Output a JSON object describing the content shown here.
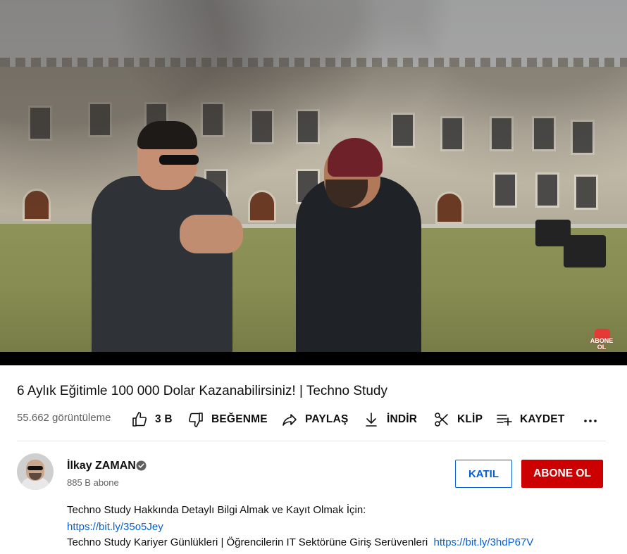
{
  "player": {
    "watermark": {
      "badge_line1": "ABONE",
      "badge_line2": "OL",
      "accent_color": "#e53935"
    }
  },
  "video": {
    "title": "6 Aylık Eğitimle 100 000 Dolar Kazanabilirsiniz! | Techno Study",
    "views": "55.662 görüntüleme"
  },
  "actions": {
    "like": {
      "label": "3 B",
      "icon": "thumbs-up-icon"
    },
    "dislike": {
      "label": "BEĞENME",
      "icon": "thumbs-down-icon"
    },
    "share": {
      "label": "PAYLAŞ",
      "icon": "share-icon"
    },
    "download": {
      "label": "İNDİR",
      "icon": "download-icon"
    },
    "clip": {
      "label": "KLİP",
      "icon": "scissors-icon"
    },
    "save": {
      "label": "KAYDET",
      "icon": "playlist-add-icon"
    },
    "more": {
      "icon": "more-horizontal-icon"
    }
  },
  "channel": {
    "name": "İlkay ZAMAN",
    "verified": true,
    "subscribers": "885 B abone",
    "join_label": "KATIL",
    "subscribe_label": "ABONE OL",
    "subscribe_color": "#cc0000",
    "join_color": "#065fd4"
  },
  "description": {
    "line1": "Techno Study Hakkında Detaylı Bilgi Almak ve Kayıt Olmak İçin:",
    "link1": "https://bit.ly/35o5Jey",
    "line3_text": "Techno Study Kariyer Günlükleri | Öğrencilerin IT Sektörüne Giriş Serüvenleri",
    "link2": "https://bit.ly/3hdP67V"
  }
}
